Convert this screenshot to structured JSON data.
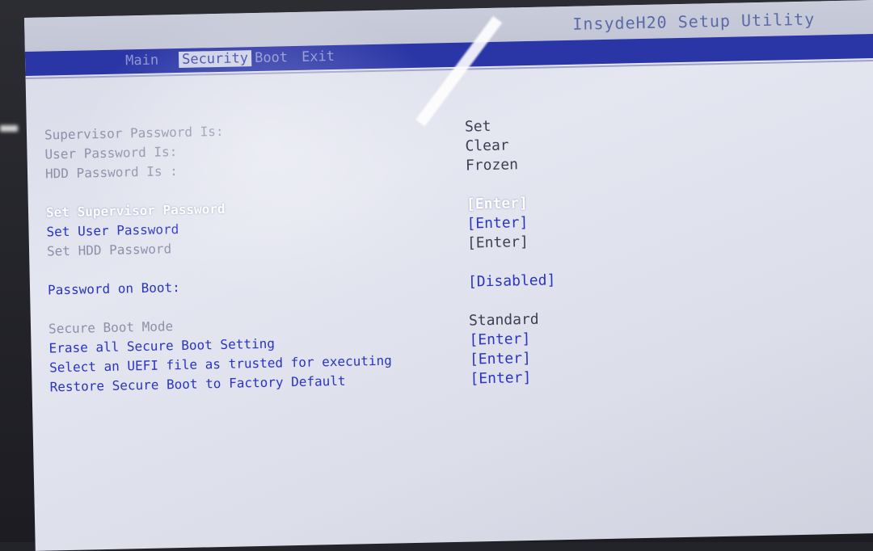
{
  "header": {
    "title": "InsydeH20 Setup Utility"
  },
  "menu": {
    "tabs": [
      {
        "label": "Main"
      },
      {
        "label": "Security"
      },
      {
        "label": "Boot"
      },
      {
        "label": "Exit"
      }
    ],
    "active": "Security"
  },
  "security": {
    "status": [
      {
        "label": "Supervisor Password Is:",
        "value": "Set"
      },
      {
        "label": "User Password Is:",
        "value": "Clear"
      },
      {
        "label": "HDD Password Is :",
        "value": "Frozen"
      }
    ],
    "passwords": [
      {
        "label": "Set Supervisor Password",
        "value": "[Enter]"
      },
      {
        "label": "Set User Password",
        "value": "[Enter]"
      },
      {
        "label": "Set HDD Password",
        "value": "[Enter]"
      }
    ],
    "boot_password": {
      "label": "Password on Boot:",
      "value": "[Disabled]"
    },
    "secure_boot": [
      {
        "label": "Secure Boot Mode",
        "value": "Standard"
      },
      {
        "label": "Erase all Secure Boot Setting",
        "value": "[Enter]"
      },
      {
        "label": "Select an UEFI file as trusted for executing",
        "value": "[Enter]"
      },
      {
        "label": "Restore Secure Boot to Factory Default",
        "value": "[Enter]"
      }
    ]
  },
  "colors": {
    "menubar": "#2a35a6",
    "option_text": "#2a34c0",
    "selected_text": "#ffffff",
    "disabled_text": "#8d90a8"
  }
}
